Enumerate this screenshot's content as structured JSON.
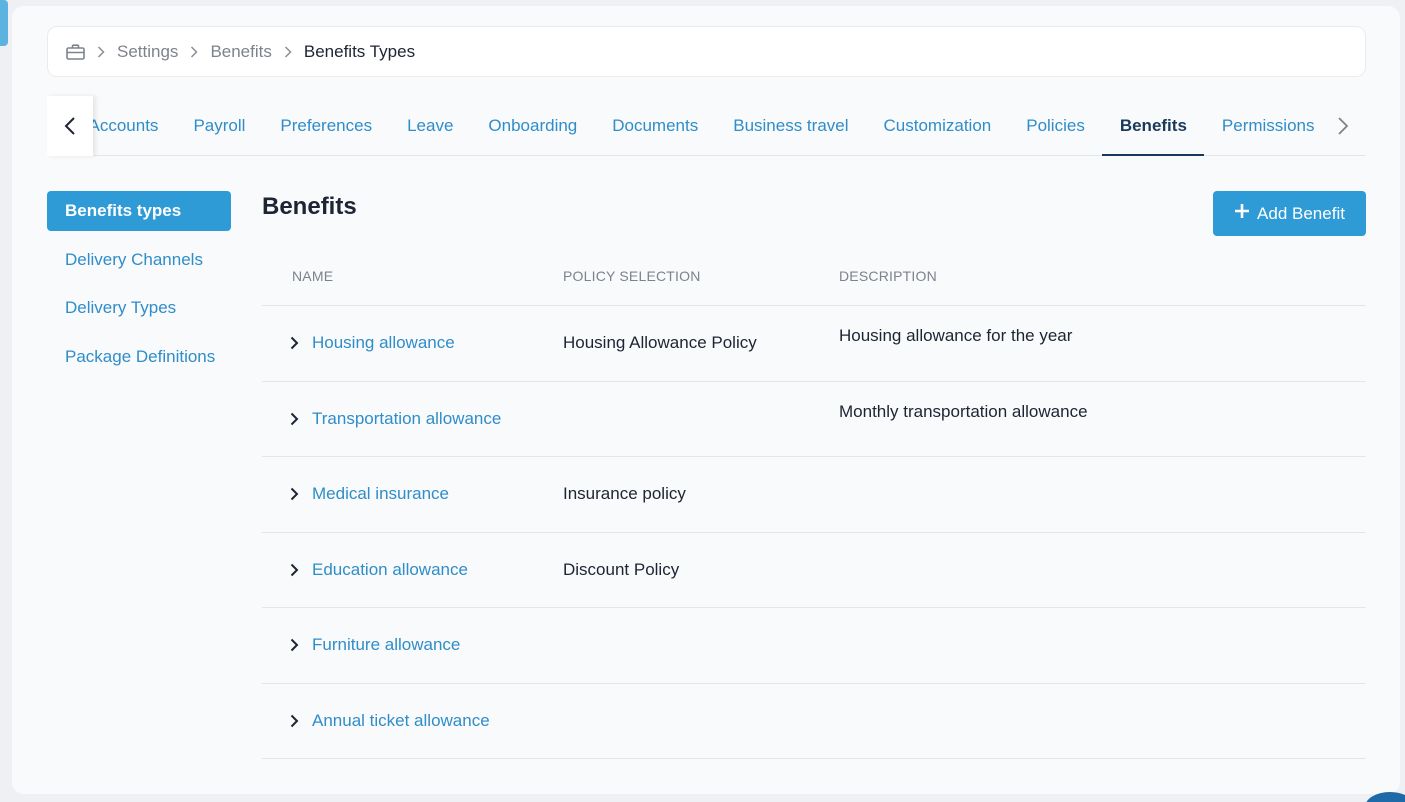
{
  "breadcrumb": {
    "home_icon": "briefcase-icon",
    "items": [
      "Settings",
      "Benefits"
    ],
    "current": "Benefits Types"
  },
  "tabs": [
    {
      "label": "Accounts"
    },
    {
      "label": "Payroll"
    },
    {
      "label": "Preferences"
    },
    {
      "label": "Leave"
    },
    {
      "label": "Onboarding"
    },
    {
      "label": "Documents"
    },
    {
      "label": "Business travel"
    },
    {
      "label": "Customization"
    },
    {
      "label": "Policies"
    },
    {
      "label": "Benefits",
      "active": true
    },
    {
      "label": "Permissions"
    }
  ],
  "sidenav": {
    "items": [
      "Benefits types",
      "Delivery Channels",
      "Delivery Types",
      "Package Definitions"
    ],
    "active_index": 0
  },
  "content": {
    "title": "Benefits",
    "add_button_label": "Add Benefit",
    "add_button_icon": "plus-icon"
  },
  "table": {
    "headers": {
      "name": "NAME",
      "policy": "POLICY SELECTION",
      "description": "DESCRIPTION"
    },
    "rows": [
      {
        "name": "Housing allowance",
        "policy": "Housing Allowance Policy",
        "description": "Housing allowance for the year"
      },
      {
        "name": "Transportation allowance",
        "policy": "",
        "description": "Monthly transportation allowance"
      },
      {
        "name": "Medical insurance",
        "policy": "Insurance policy",
        "description": ""
      },
      {
        "name": "Education allowance",
        "policy": "Discount Policy",
        "description": ""
      },
      {
        "name": "Furniture allowance",
        "policy": "",
        "description": ""
      },
      {
        "name": "Annual ticket allowance",
        "policy": "",
        "description": ""
      }
    ]
  },
  "colors": {
    "accent": "#2f9bd6",
    "link": "#2f8dc9",
    "active_tab": "#1a3a5c",
    "text": "#1d2433"
  }
}
